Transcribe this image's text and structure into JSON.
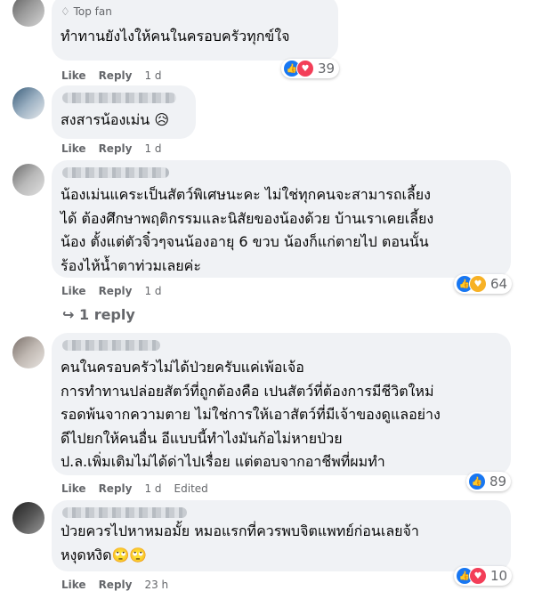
{
  "comments": [
    {
      "badge_icon": "diamond-icon",
      "badge": "Top fan",
      "text": "ทำทานยังไงให้คนในครอบครัวทุกข์ใจ",
      "like": "Like",
      "reply": "Reply",
      "time": "1 d",
      "reactions": [
        "like",
        "love"
      ],
      "count": "39"
    },
    {
      "text": "สงสารน้องเม่น 😥",
      "like": "Like",
      "reply": "Reply",
      "time": "1 d"
    },
    {
      "text": "น้องเม่นแคระเป็นสัตว์พิเศษนะคะ ไม่ใช่ทุกคนจะสามารถเลี้ยง\nได้ ต้องศึกษาพฤติกรรมและนิสัยของน้องด้วย บ้านเราเคยเลี้ยง\nน้อง ตั้งแต่ตัวจิ๋วๆจนน้องอายุ 6 ขวบ น้องก็แก่ตายไป ตอนนั้น\nร้องไห้น้ำตาท่วมเลยค่ะ",
      "like": "Like",
      "reply": "Reply",
      "time": "1 d",
      "reactions": [
        "like",
        "care"
      ],
      "count": "64",
      "replies": "1 reply"
    },
    {
      "text": "คนในครอบครัวไม่ได้ป่วยครับแค่เพ้อเจ้อ\nการทำทานปล่อยสัตว์ที่ถูกต้องคือ เปนสัตว์ที่ต้องการมีชีวิตใหม่\nรอดพ้นจากความตาย ไม่ใช่การให้เอาสัตว์ที่มีเจ้าของดูแลอย่าง\nดีไปยกให้คนอื่น อีแบบนี้ทำไงมันก้อไม่หายป่วย\nป.ล.เพิ่มเติมไม่ได้ด่าไปเรื่อย แต่ตอบจากอาชีพที่ผมทำ",
      "like": "Like",
      "reply": "Reply",
      "time": "1 d",
      "edited": "Edited",
      "reactions": [
        "like"
      ],
      "count": "89"
    },
    {
      "text": "ป่วยควรไปหาหมอมั้ย หมอแรกที่ควรพบจิตแพทย์ก่อนเลยจ้า\nหงุดหงิด🙄🙄",
      "like": "Like",
      "reply": "Reply",
      "time": "23 h",
      "reactions": [
        "like",
        "love"
      ],
      "count": "10"
    }
  ],
  "colors": {
    "like": "#1877f2",
    "love": "#f33e58",
    "care": "#f7b125",
    "bubble": "#f0f2f5",
    "meta": "#65676b"
  }
}
